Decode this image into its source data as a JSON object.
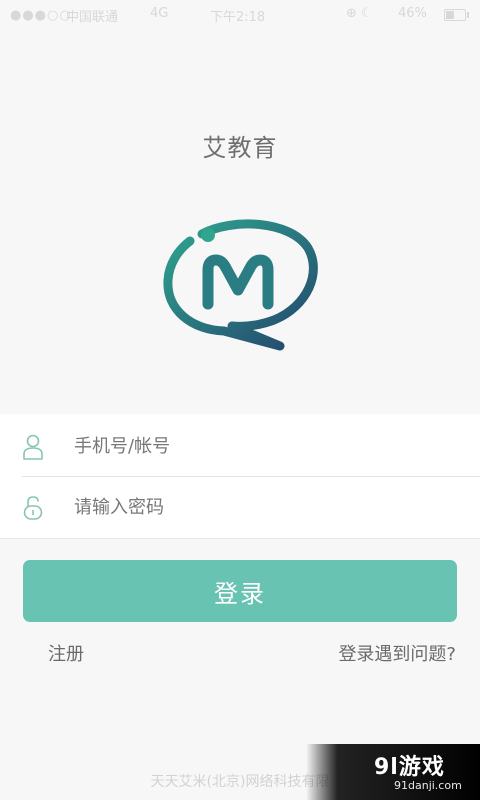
{
  "status_bar": {
    "signal": "●●●○○",
    "carrier": "中国联通",
    "network": "4G",
    "time": "下午2:18",
    "icons_text": "⊕ ☾",
    "battery": "46%",
    "battery_level": 0.46
  },
  "app": {
    "title": "艾教育",
    "colors": {
      "accent": "#68c3b3",
      "logo_teal": "#2f9f8c",
      "logo_navy": "#26476c"
    }
  },
  "login_form": {
    "username_placeholder": "手机号/帐号",
    "password_placeholder": "请输入密码",
    "user_icon": "user-icon",
    "lock_icon": "lock-icon"
  },
  "actions": {
    "login_label": "登录",
    "register_label": "注册",
    "help_label": "登录遇到问题?"
  },
  "footer": {
    "company": "天天艾米(北京)网络科技有限"
  },
  "watermark": {
    "logo_text": "9l游戏",
    "url": "91danji.com"
  }
}
